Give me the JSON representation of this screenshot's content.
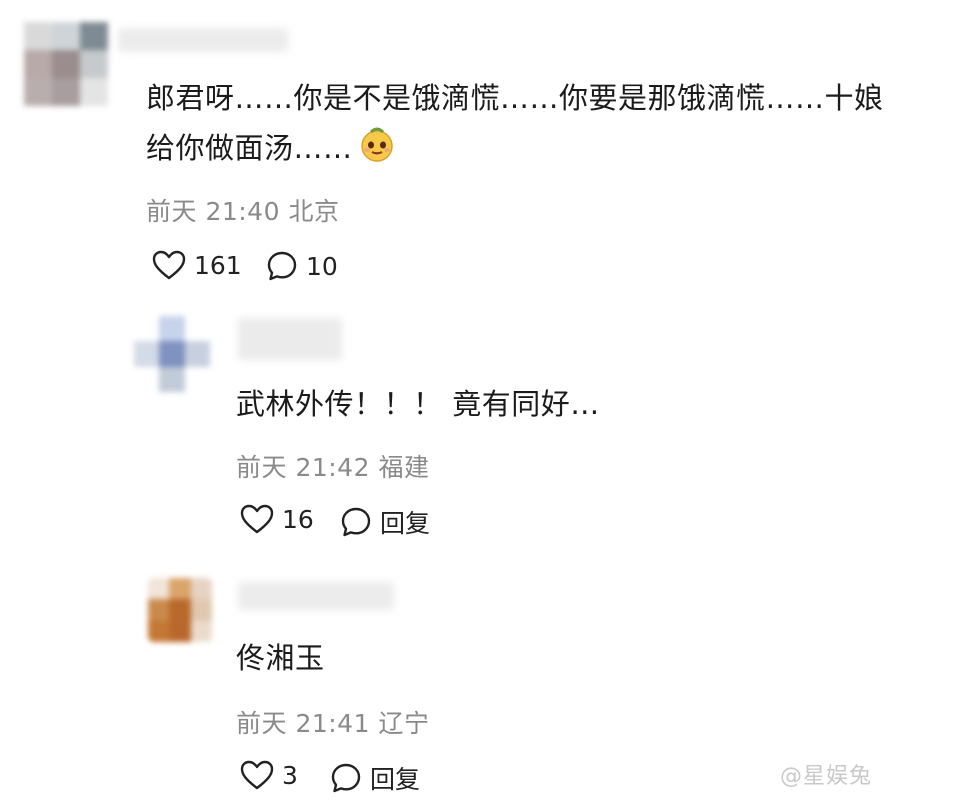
{
  "comments": [
    {
      "text_line1": "郎君呀……你是不是饿滴慌……你要是那饿滴慌……十娘",
      "text_line2": "给你做面汤……",
      "emoji": "smiling-face-emoji",
      "meta": "前天 21:40 北京",
      "likes": "161",
      "replies": "10"
    },
    {
      "text": "武林外传！！！ 竟有同好…",
      "meta": "前天 21:42 福建",
      "likes": "16",
      "reply_label": "回复"
    },
    {
      "text": "佟湘玉",
      "meta": "前天 21:41 辽宁",
      "likes": "3",
      "reply_label": "回复"
    }
  ],
  "watermark": "@星娱兔",
  "colors": {
    "text": "#1b1b1b",
    "meta": "#8a8a8a",
    "icon": "#222222"
  },
  "icons": [
    "heart-icon",
    "comment-bubble-icon"
  ]
}
